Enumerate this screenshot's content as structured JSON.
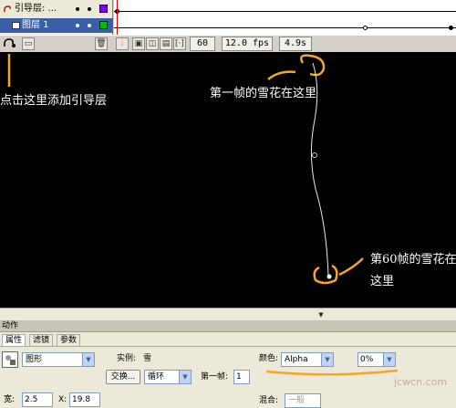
{
  "timeline": {
    "layers": [
      {
        "name": "引导层: ...",
        "color": "#8000ff"
      },
      {
        "name": "图层 1",
        "color": "#00c000"
      }
    ],
    "current_frame": "60",
    "frame_rate": "12.0 fps",
    "elapsed": "4.9s"
  },
  "annotations": {
    "add_guide": "点击这里添加引导层",
    "first_frame": "第一帧的雪花在这里",
    "frame60_line1": "第60帧的雪花在",
    "frame60_line2": "这里"
  },
  "panels": {
    "actions_title": "动作"
  },
  "properties": {
    "tabs": [
      "属性",
      "滤镜",
      "参数"
    ],
    "symbol_type": "图形",
    "instance_label": "实例:",
    "instance_name": "雪",
    "swap_button": "交换...",
    "loop_mode": "循环",
    "first_frame_label": "第一帧:",
    "first_frame_value": "1",
    "color_label": "颜色:",
    "color_mode": "Alpha",
    "alpha_value": "0%",
    "width_label": "宽:",
    "width_value": "2.5",
    "x_label": "X:",
    "x_value": "19.8",
    "blend_label": "混合:",
    "blend_value": "一般"
  },
  "watermark": "jcwcn.com",
  "colors": {
    "stage": "#000000",
    "selected_layer": "#3a5fa8",
    "highlight": "#f5a623"
  }
}
